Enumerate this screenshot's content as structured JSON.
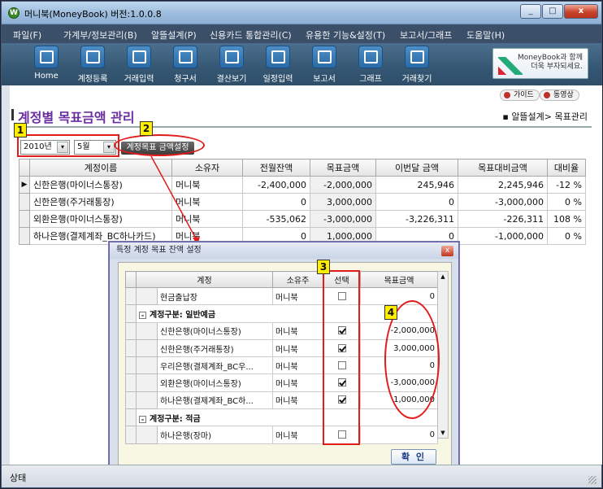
{
  "window": {
    "title": "머니북(MoneyBook) 버전:1.0.0.8",
    "app_icon": "W",
    "min_icon": "_",
    "max_icon": "□",
    "close_icon": "x"
  },
  "menu": [
    "파일(F)",
    "가계부/정보관리(B)",
    "알뜰설계(P)",
    "신용카드 통합관리(C)",
    "유용한 기능&설정(T)",
    "보고서/그래프",
    "도움말(H)"
  ],
  "toolbar": [
    {
      "label": "Home",
      "icon": "home-icon"
    },
    {
      "label": "계정등록",
      "icon": "account-register-icon"
    },
    {
      "label": "거래입력",
      "icon": "transaction-entry-icon"
    },
    {
      "label": "청구서",
      "icon": "card-bill-icon"
    },
    {
      "label": "결산보기",
      "icon": "settlement-icon"
    },
    {
      "label": "일정입력",
      "icon": "calendar-icon"
    },
    {
      "label": "보고서",
      "icon": "report-icon"
    },
    {
      "label": "그래프",
      "icon": "graph-icon"
    },
    {
      "label": "거래찾기",
      "icon": "search-icon"
    }
  ],
  "banner": {
    "line1": "MoneyBook과 함께",
    "line2": "더욱 부자되세요."
  },
  "guide_buttons": [
    "가이드",
    "동영상"
  ],
  "page": {
    "title": "계정별 목표금액 관리",
    "breadcrumb": "알뜰설계> 목표관리",
    "year": "2010년",
    "month": "5월",
    "dropdown_arrow": "▾",
    "set_button": "계정목표 금액설정"
  },
  "markers": [
    "1",
    "2",
    "3",
    "4"
  ],
  "grid": {
    "row_pointer": "▶",
    "columns": [
      "계정이름",
      "소유자",
      "전월잔액",
      "목표금액",
      "이번달 금액",
      "목표대비금액",
      "대비율"
    ],
    "rows": [
      [
        "신한은행(마이너스통장)",
        "머니북",
        "-2,400,000",
        "-2,000,000",
        "245,946",
        "2,245,946",
        "-12 %"
      ],
      [
        "신한은행(주거래통장)",
        "머니북",
        "0",
        "3,000,000",
        "0",
        "-3,000,000",
        "0 %"
      ],
      [
        "외환은행(마이너스통장)",
        "머니북",
        "-535,062",
        "-3,000,000",
        "-3,226,311",
        "-226,311",
        "108 %"
      ],
      [
        "하나은행(결제계좌_BC하나카드)",
        "머니북",
        "0",
        "1,000,000",
        "0",
        "-1,000,000",
        "0 %"
      ]
    ]
  },
  "dialog": {
    "title": "특정 계정 목표 잔액 설정",
    "close_icon": "x",
    "columns": [
      "계정",
      "소유주",
      "선택",
      "목표금액"
    ],
    "rows": [
      {
        "type": "item",
        "name": "현금출납장",
        "owner": "머니북",
        "checked": false,
        "amount": "0"
      },
      {
        "type": "group",
        "toggle": "-",
        "label": "계정구분: 일반예금"
      },
      {
        "type": "item",
        "name": "신한은행(마이너스통장)",
        "owner": "머니북",
        "checked": true,
        "amount": "-2,000,000"
      },
      {
        "type": "item",
        "name": "신한은행(주거래통장)",
        "owner": "머니북",
        "checked": true,
        "amount": "3,000,000"
      },
      {
        "type": "item",
        "name": "우리은행(결제계좌_BC우...",
        "owner": "머니북",
        "checked": false,
        "amount": "0"
      },
      {
        "type": "item",
        "name": "외환은행(마이너스통장)",
        "owner": "머니북",
        "checked": true,
        "amount": "-3,000,000"
      },
      {
        "type": "item",
        "name": "하나은행(결제계좌_BC하...",
        "owner": "머니북",
        "checked": true,
        "amount": "1,000,000"
      },
      {
        "type": "group",
        "toggle": "-",
        "label": "계정구분: 적금"
      },
      {
        "type": "item",
        "name": "하나은행(장마)",
        "owner": "머니북",
        "checked": false,
        "amount": "0"
      }
    ],
    "scroll_up": "▲",
    "scroll_down": "▼",
    "ok_button": "확 인"
  },
  "status": {
    "text": "상태"
  }
}
